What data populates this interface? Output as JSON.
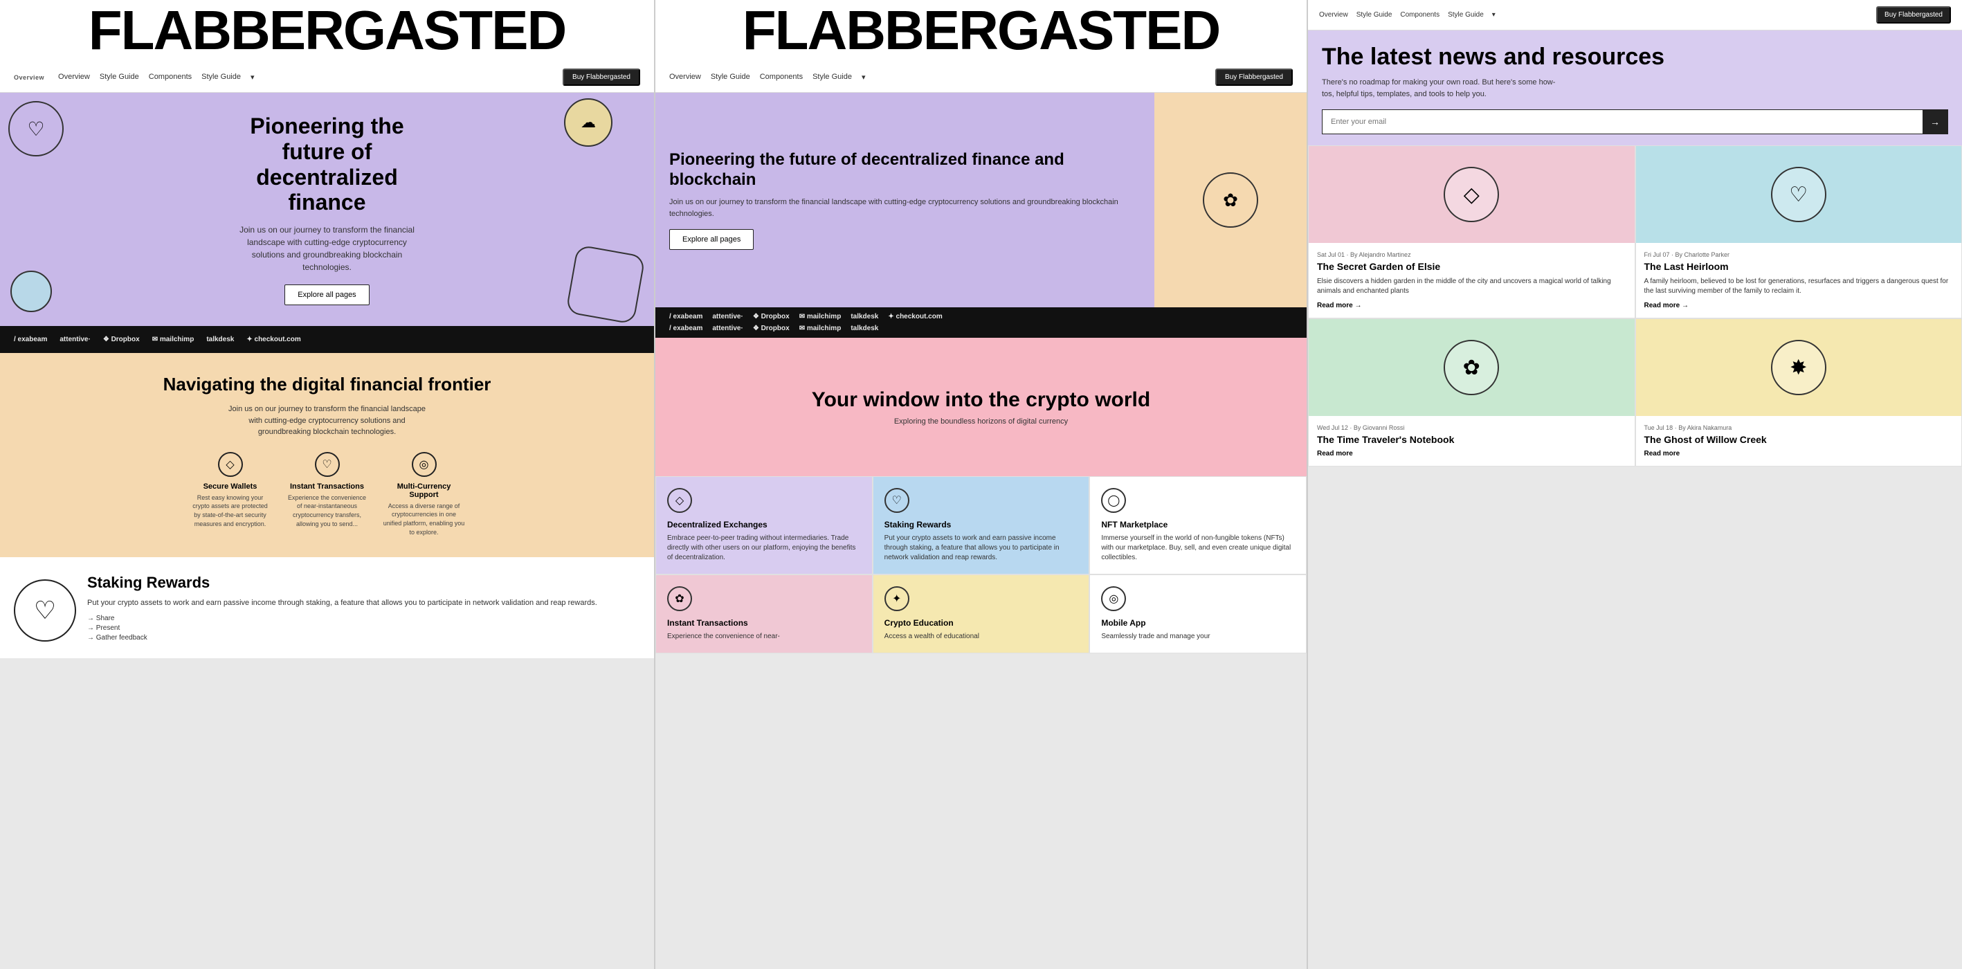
{
  "col1": {
    "bigtitle": "FLABBERGASTED",
    "nav": {
      "links": [
        "Overview",
        "Style Guide",
        "Components",
        "Style Guide"
      ],
      "style_guide_arrow": "▾",
      "cta": "Buy Flabbergasted"
    },
    "hero": {
      "title": "Pioneering the future of decentralized finance",
      "subtitle": "Join us on our journey to transform the financial landscape with cutting-edge cryptocurrency solutions and groundbreaking blockchain technologies.",
      "cta": "Explore all pages"
    },
    "logos": [
      {
        "name": "exabeam",
        "prefix": "/"
      },
      {
        "name": "attentive",
        "prefix": ""
      },
      {
        "name": "Dropbox",
        "prefix": "❖ "
      },
      {
        "name": "mailchimp",
        "prefix": "✉ "
      },
      {
        "name": "talkdesk",
        "prefix": ""
      },
      {
        "name": "checkout.com",
        "prefix": ""
      }
    ],
    "section_nav": {
      "title": "Navigating the digital financial frontier",
      "subtitle": "Join us on our journey to transform the financial landscape with cutting-edge cryptocurrency solutions and groundbreaking blockchain technologies.",
      "features": [
        {
          "icon": "◇",
          "title": "Secure Wallets",
          "desc": "Rest easy knowing your crypto assets are protected by state-of-the-art security measures and encryption."
        },
        {
          "icon": "♡",
          "title": "Instant Transactions",
          "desc": "Experience the convenience of near-instantaneous cryptocurrency transfers, allowing you to send..."
        },
        {
          "icon": "◎",
          "title": "Multi-Currency Support",
          "desc": "Access a diverse range of cryptocurrencies in one unified platform, enabling you to explore."
        }
      ]
    },
    "staking": {
      "title": "Staking Rewards",
      "desc": "Put your crypto assets to work and earn passive income through staking, a feature that allows you to participate in network validation and reap rewards.",
      "links": [
        "Share",
        "Present",
        "Gather feedback"
      ]
    }
  },
  "col2": {
    "bigtitle": "FLABBERGASTED",
    "nav": {
      "links": [
        "Overview",
        "Style Guide",
        "Components",
        "Style Guide"
      ],
      "cta": "Buy Flabbergasted"
    },
    "hero": {
      "title": "Pioneering the future of decentralized finance and blockchain",
      "subtitle": "Join us on our journey to transform the financial landscape with cutting-edge cryptocurrency solutions and groundbreaking blockchain technologies.",
      "cta": "Explore all pages"
    },
    "logos": [
      {
        "name": "exabeam"
      },
      {
        "name": "attentive"
      },
      {
        "name": "Dropbox"
      },
      {
        "name": "mailchimp"
      },
      {
        "name": "talkdesk"
      },
      {
        "name": "checkout.com"
      }
    ],
    "window": {
      "title": "Your window into the crypto world",
      "subtitle": "Exploring the boundless horizons of digital currency"
    },
    "cards": [
      {
        "bg": "purple",
        "icon": "◇",
        "title": "Decentralized Exchanges",
        "desc": "Embrace peer-to-peer trading without intermediaries. Trade directly with other users on our platform, enjoying the benefits of decentralization."
      },
      {
        "bg": "blue",
        "icon": "♡",
        "title": "Staking Rewards",
        "desc": "Put your crypto assets to work and earn passive income through staking, a feature that allows you to participate in network validation and reap rewards."
      },
      {
        "bg": "default",
        "icon": "◯",
        "title": "NFT Marketplace",
        "desc": "Immerse yourself in the world of non-fungible tokens (NFTs) with our marketplace. Buy, sell, and even create unique digital collectibles."
      },
      {
        "bg": "pink",
        "icon": "✿",
        "title": "Instant Transactions",
        "desc": "Experience the convenience of near-"
      },
      {
        "bg": "yellow",
        "icon": "✦",
        "title": "Crypto Education",
        "desc": "Access a wealth of educational"
      },
      {
        "bg": "default",
        "icon": "◎",
        "title": "Mobile App",
        "desc": "Seamlessly trade and manage your"
      }
    ]
  },
  "col3": {
    "nav": {
      "links": [
        "Overview",
        "Style Guide",
        "Components",
        "Style Guide"
      ],
      "cta": "Buy Flabbergasted"
    },
    "news": {
      "title": "The latest news and resources",
      "subtitle": "There's no roadmap for making your own road. But here's some how-tos, helpful tips, templates, and tools to help you.",
      "email_placeholder": "Enter your email",
      "email_btn": "→"
    },
    "articles": [
      {
        "color": "pink",
        "icon": "◇",
        "meta": "Sat Jul 01 · By Alejandro Martinez",
        "title": "The Secret Garden of Elsie",
        "desc": "Elsie discovers a hidden garden in the middle of the city and uncovers a magical world of talking animals and enchanted plants",
        "read_more": "Read more →"
      },
      {
        "color": "blue",
        "icon": "♡",
        "meta": "Fri Jul 07 · By Charlotte Parker",
        "title": "The Last Heirloom",
        "desc": "A family heirloom, believed to be lost for generations, resurfaces and triggers a dangerous quest for the last surviving member of the family to reclaim it.",
        "read_more": "Read more →"
      },
      {
        "color": "green",
        "icon": "✿",
        "meta": "Wed Jul 12 · By Giovanni Rossi",
        "title": "The Time Traveler's Notebook",
        "desc": "",
        "read_more": "Read more"
      },
      {
        "color": "yellow",
        "icon": "✸",
        "meta": "Tue Jul 18 · By Akira Nakamura",
        "title": "The Ghost of Willow Creek",
        "desc": "",
        "read_more": "Read more"
      }
    ]
  }
}
